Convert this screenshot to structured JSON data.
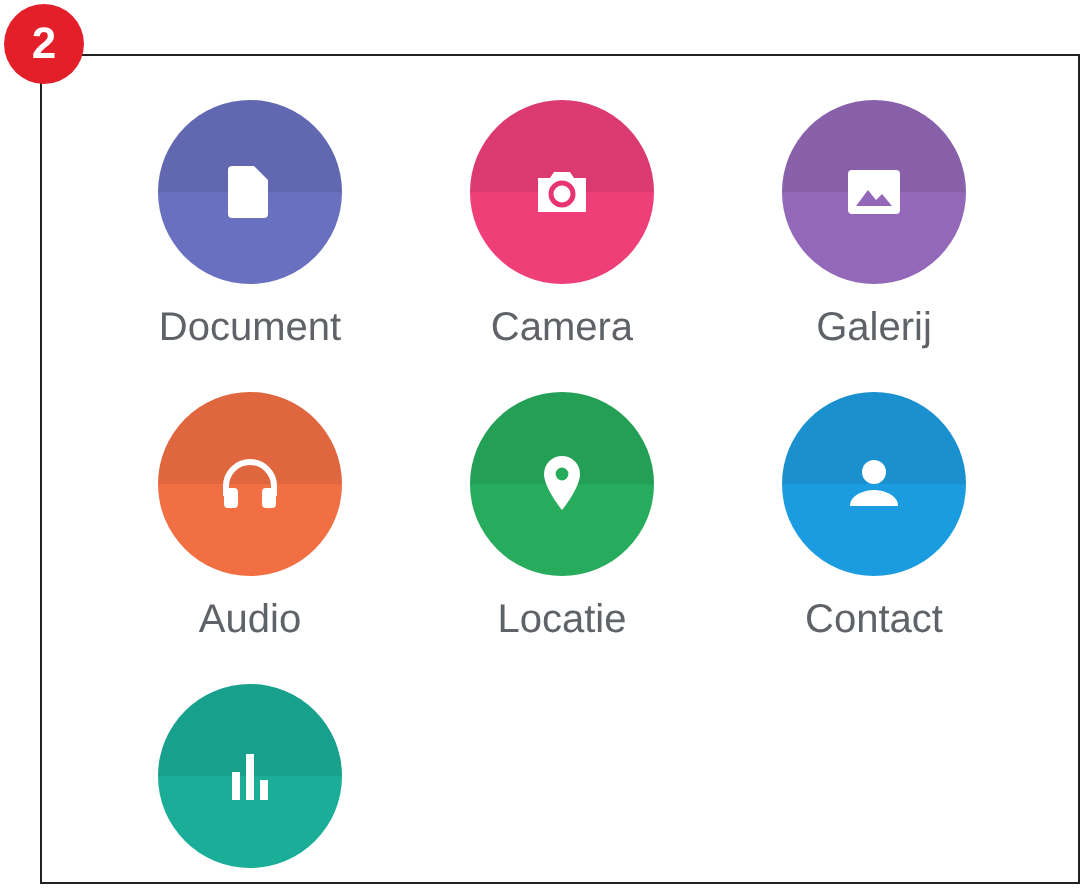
{
  "step_badge": "2",
  "attachments": [
    {
      "kind": "document",
      "label": "Document",
      "color": "#6970bf"
    },
    {
      "kind": "camera",
      "label": "Camera",
      "color": "#ee3f79"
    },
    {
      "kind": "gallery",
      "label": "Galerij",
      "color": "#9468b8"
    },
    {
      "kind": "audio",
      "label": "Audio",
      "color": "#f26f43"
    },
    {
      "kind": "location",
      "label": "Locatie",
      "color": "#27ac5d"
    },
    {
      "kind": "contact",
      "label": "Contact",
      "color": "#1c9ce0"
    },
    {
      "kind": "poll",
      "color": "#1aae99"
    }
  ]
}
